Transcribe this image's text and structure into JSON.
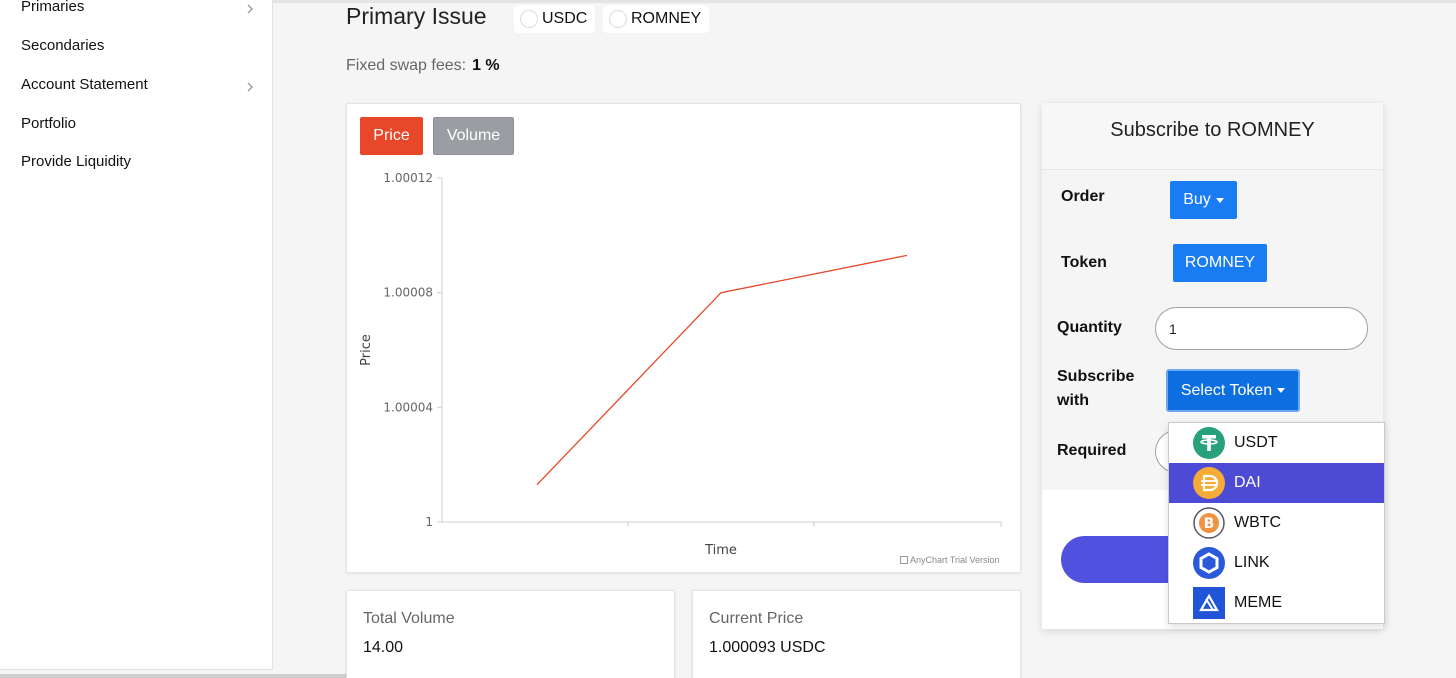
{
  "sidebar": {
    "items": [
      {
        "label": "Primaries",
        "chevron": true
      },
      {
        "label": "Secondaries",
        "chevron": false
      },
      {
        "label": "Account Statement",
        "chevron": true
      },
      {
        "label": "Portfolio",
        "chevron": false
      },
      {
        "label": "Provide Liquidity",
        "chevron": false
      }
    ]
  },
  "header": {
    "title": "Primary Issue",
    "token_a": "USDC",
    "token_b": "ROMNEY",
    "fees_label": "Fixed swap fees:",
    "fees_value": "1 %"
  },
  "chart_tabs": {
    "price": "Price",
    "volume": "Volume",
    "active": "Price"
  },
  "chart_data": {
    "type": "line",
    "xlabel": "Time",
    "ylabel": "Price",
    "ylim": [
      1,
      1.00012
    ],
    "yticks": [
      "1.00012",
      "1.00008",
      "1.00004",
      "1"
    ],
    "series": [
      {
        "values": [
          1.000013,
          1.00008,
          1.000093
        ]
      }
    ],
    "line_color": "#e8472a",
    "watermark": "AnyChart Trial Version"
  },
  "stats": {
    "total_volume_label": "Total Volume",
    "total_volume_value": "14.00",
    "current_price_label": "Current Price",
    "current_price_value": "1.000093 USDC"
  },
  "subscribe": {
    "title": "Subscribe to ROMNEY",
    "order_label": "Order",
    "order_value": "Buy",
    "token_label": "Token",
    "token_value": "ROMNEY",
    "quantity_label": "Quantity",
    "quantity_value": "1",
    "subscribe_with_label_1": "Subscribe",
    "subscribe_with_label_2": "with",
    "select_token": "Select Token",
    "required_label": "Required"
  },
  "token_dropdown": {
    "selected": "DAI",
    "options": [
      {
        "label": "USDT",
        "icon": "usdt-icon",
        "color": "#26a17b"
      },
      {
        "label": "DAI",
        "icon": "dai-icon",
        "color": "#f5ac37"
      },
      {
        "label": "WBTC",
        "icon": "wbtc-icon",
        "color": "#f09242"
      },
      {
        "label": "LINK",
        "icon": "link-icon",
        "color": "#2a5ada"
      },
      {
        "label": "MEME",
        "icon": "meme-icon",
        "color": "#1f55d6"
      }
    ]
  },
  "colors": {
    "primary": "#1a7cf3",
    "accent": "#e8472a",
    "highlight": "#4d4bd6"
  }
}
